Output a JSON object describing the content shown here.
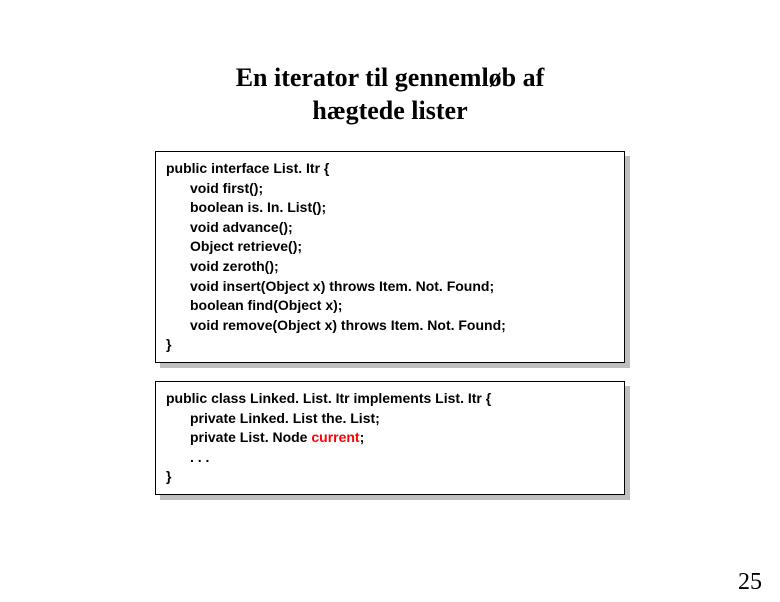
{
  "title_line1": "En iterator til gennemløb af",
  "title_line2": "hægtede lister",
  "box1": {
    "l0": "public interface List. Itr {",
    "l1": "void first();",
    "l2": "boolean is. In. List();",
    "l3": "void advance();",
    "l4": "Object retrieve();",
    "l5": "void zeroth();",
    "l6": "void insert(Object x) throws Item. Not. Found;",
    "l7": "boolean find(Object x);",
    "l8": "void remove(Object x) throws Item. Not. Found;",
    "l9": "}"
  },
  "box2": {
    "l0": "public class Linked. List. Itr implements List. Itr {",
    "l1": "private Linked. List the. List;",
    "l2a": "private List. Node ",
    "l2b": "current",
    "l2c": ";",
    "l3": ". . .",
    "l4": "}"
  },
  "page_number": "25"
}
